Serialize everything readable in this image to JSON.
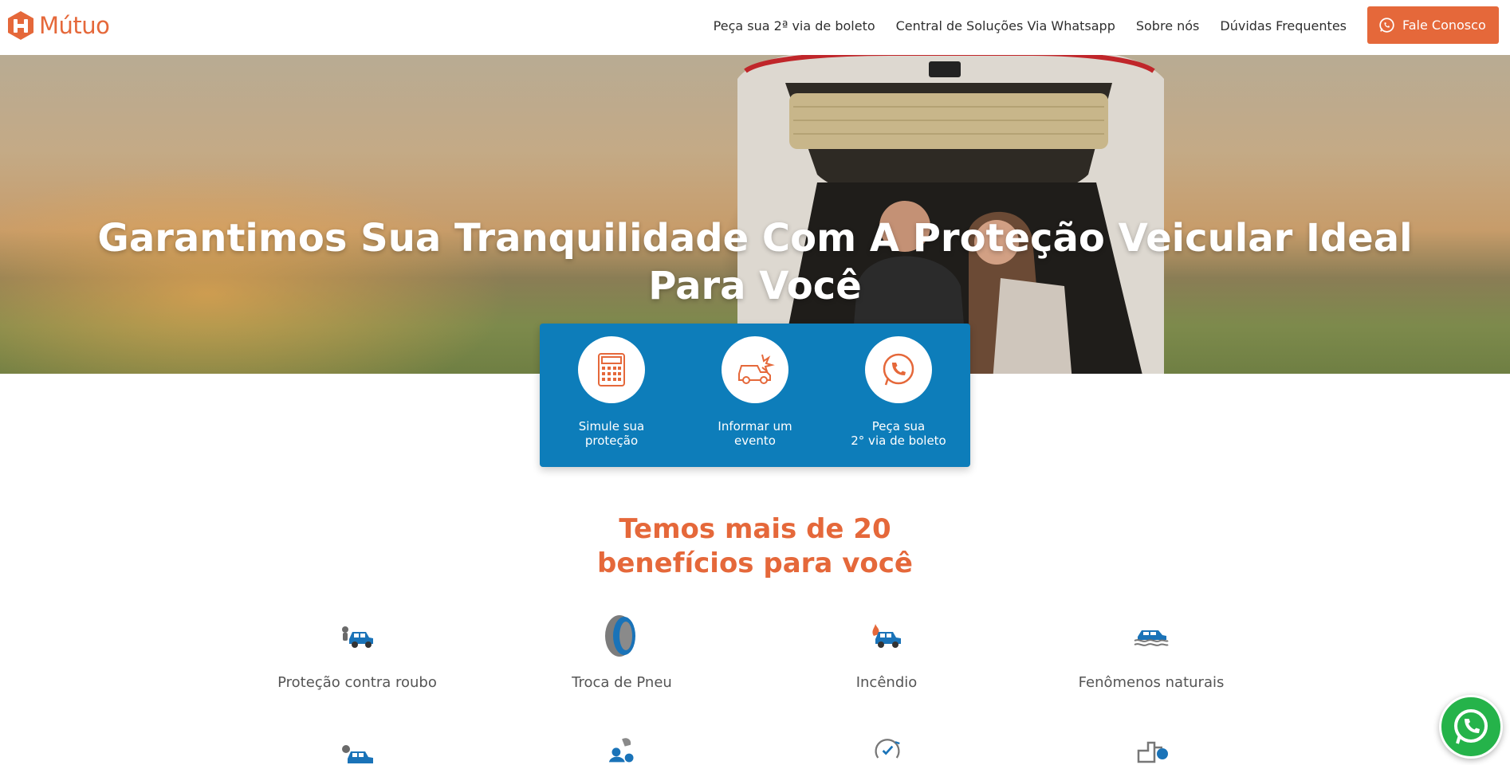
{
  "header": {
    "logo_text": "Mútuo",
    "nav": [
      {
        "label": "Peça sua 2ª via de boleto"
      },
      {
        "label": "Central de Soluções Via Whatsapp"
      },
      {
        "label": "Sobre nós"
      },
      {
        "label": "Dúvidas Frequentes"
      }
    ],
    "cta_label": "Fale Conosco"
  },
  "hero": {
    "title": "Garantimos Sua Tranquilidade Com A Proteção Veicular Ideal Para Você"
  },
  "actions": [
    {
      "label_line1": "Simule sua",
      "label_line2": "proteção",
      "icon": "calculator-icon"
    },
    {
      "label_line1": "Informar um",
      "label_line2": "evento",
      "icon": "car-crash-icon"
    },
    {
      "label_line1": "Peça sua",
      "label_line2": "2° via de boleto",
      "icon": "whatsapp-icon"
    }
  ],
  "benefits": {
    "title_line1": "Temos mais de 20",
    "title_line2": "benefícios para você",
    "items": [
      {
        "label": "Proteção contra roubo",
        "icon": "car-theft-icon"
      },
      {
        "label": "Troca de Pneu",
        "icon": "tire-icon"
      },
      {
        "label": "Incêndio",
        "icon": "car-fire-icon"
      },
      {
        "label": "Fenômenos naturais",
        "icon": "flood-car-icon"
      }
    ]
  },
  "colors": {
    "brand_orange": "#e5683a",
    "panel_blue": "#0d7dba",
    "whatsapp_green": "#25b34a"
  }
}
